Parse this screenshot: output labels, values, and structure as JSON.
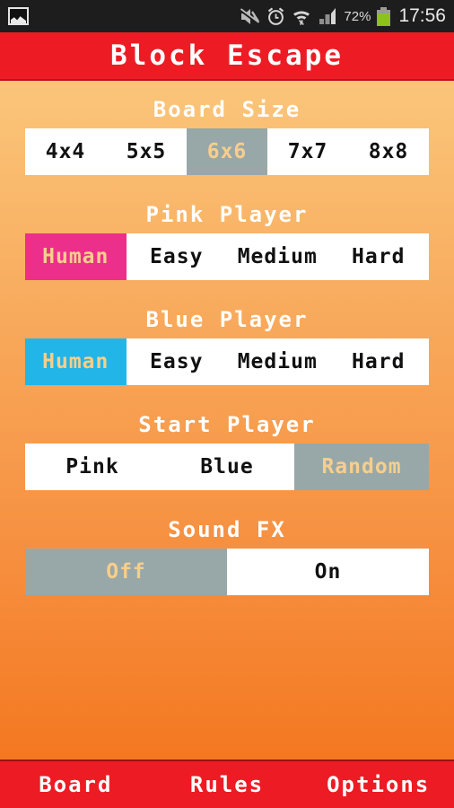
{
  "status_bar": {
    "left_icons": [
      {
        "name": "screenshot-photo-icon",
        "glyph": "photo"
      }
    ],
    "right_icons": [
      {
        "name": "sound-mute-icon",
        "glyph": "speaker-muted"
      },
      {
        "name": "alarm-clock-icon",
        "glyph": "alarm"
      },
      {
        "name": "wifi-icon",
        "glyph": "wifi-transfer"
      },
      {
        "name": "cellular-signal-icon",
        "glyph": "signal-bars"
      }
    ],
    "battery_percent": "72%",
    "time": "17:56"
  },
  "title_bar": {
    "title": "Block Escape",
    "background_color": "#ED1C24",
    "text_color": "#FFFFFF"
  },
  "theme": {
    "bg_gradient_top": "#FBCC82",
    "bg_gradient_bottom": "#F4711B",
    "selected_gray": "#98A8A8",
    "selected_pink": "#EC2F8A",
    "selected_blue": "#22B5E8",
    "selected_text": "#F7CE8C",
    "option_text": "#111111",
    "label_text": "#FFFFFF"
  },
  "sections": [
    {
      "key": "board_size",
      "label": "Board Size",
      "selected": "6x6",
      "selected_style": "gray",
      "options": [
        {
          "label": "4x4",
          "selected": false
        },
        {
          "label": "5x5",
          "selected": false
        },
        {
          "label": "6x6",
          "selected": true
        },
        {
          "label": "7x7",
          "selected": false
        },
        {
          "label": "8x8",
          "selected": false
        }
      ]
    },
    {
      "key": "pink_player",
      "label": "Pink Player",
      "selected": "Human",
      "selected_style": "pink",
      "options": [
        {
          "label": "Human",
          "selected": true
        },
        {
          "label": "Easy",
          "selected": false
        },
        {
          "label": "Medium",
          "selected": false
        },
        {
          "label": "Hard",
          "selected": false
        }
      ]
    },
    {
      "key": "blue_player",
      "label": "Blue Player",
      "selected": "Human",
      "selected_style": "blue",
      "options": [
        {
          "label": "Human",
          "selected": true
        },
        {
          "label": "Easy",
          "selected": false
        },
        {
          "label": "Medium",
          "selected": false
        },
        {
          "label": "Hard",
          "selected": false
        }
      ]
    },
    {
      "key": "start_player",
      "label": "Start Player",
      "selected": "Random",
      "selected_style": "gray",
      "options": [
        {
          "label": "Pink",
          "selected": false
        },
        {
          "label": "Blue",
          "selected": false
        },
        {
          "label": "Random",
          "selected": true
        }
      ]
    },
    {
      "key": "sound_fx",
      "label": "Sound FX",
      "selected": "Off",
      "selected_style": "gray",
      "options": [
        {
          "label": "Off",
          "selected": true
        },
        {
          "label": "On",
          "selected": false
        }
      ]
    }
  ],
  "bottom_nav": {
    "items": [
      {
        "label": "Board",
        "name": "nav-board"
      },
      {
        "label": "Rules",
        "name": "nav-rules"
      },
      {
        "label": "Options",
        "name": "nav-options"
      }
    ]
  }
}
